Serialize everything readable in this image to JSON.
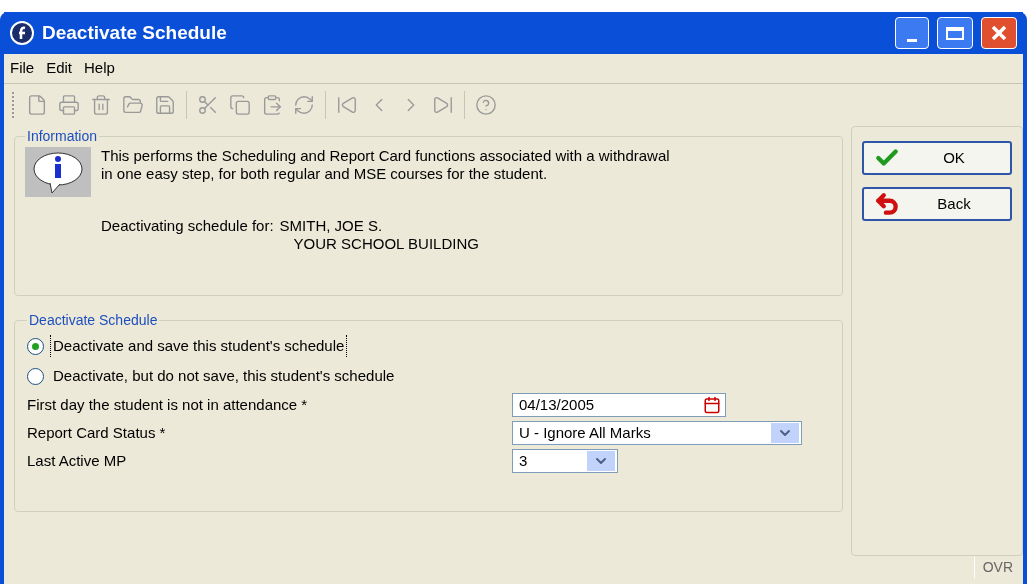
{
  "window": {
    "title": "Deactivate Schedule"
  },
  "menu": [
    "File",
    "Edit",
    "Help"
  ],
  "toolbar": [
    {
      "kind": "new"
    },
    {
      "kind": "print"
    },
    {
      "kind": "delete"
    },
    {
      "kind": "open"
    },
    {
      "kind": "save"
    },
    {
      "kind": "separator"
    },
    {
      "kind": "cut"
    },
    {
      "kind": "copy"
    },
    {
      "kind": "paste"
    },
    {
      "kind": "refresh"
    },
    {
      "kind": "separator"
    },
    {
      "kind": "first"
    },
    {
      "kind": "prev"
    },
    {
      "kind": "next"
    },
    {
      "kind": "last"
    },
    {
      "kind": "separator"
    },
    {
      "kind": "help"
    }
  ],
  "information": {
    "title": "Information",
    "text": "This performs the Scheduling and Report Card functions associated with a withdrawal in one easy step, for both regular and MSE courses for the student.",
    "student_label": "Deactivating schedule for:",
    "student_name": "SMITH, JOE S.",
    "building": "YOUR SCHOOL BUILDING"
  },
  "deactivate": {
    "title": "Deactivate Schedule",
    "options": [
      {
        "label": "Deactivate and save this student's schedule",
        "selected": true
      },
      {
        "label": "Deactivate, but do not save, this student's schedule",
        "selected": false
      }
    ],
    "fields": [
      {
        "label": "First day the student is not in attendance *",
        "kind": "date",
        "value": "04/13/2005"
      },
      {
        "label": "Report Card Status *",
        "kind": "select",
        "value": "U - Ignore All Marks"
      },
      {
        "label": "Last Active MP",
        "kind": "select-small",
        "value": "3"
      }
    ]
  },
  "buttons": [
    {
      "label": "OK",
      "kind": "ok"
    },
    {
      "label": "Back",
      "kind": "back"
    }
  ],
  "status_bar": {
    "mode": "OVR"
  }
}
